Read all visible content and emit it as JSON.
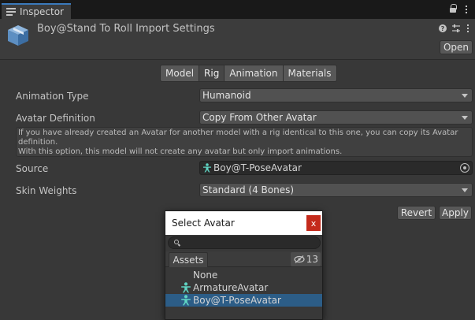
{
  "window": {
    "tab_label": "Inspector"
  },
  "header": {
    "title": "Boy@Stand To Roll Import Settings",
    "open_label": "Open"
  },
  "toolbar": {
    "tabs": [
      "Model",
      "Rig",
      "Animation",
      "Materials"
    ],
    "active": "Rig"
  },
  "rig": {
    "animation_type_label": "Animation Type",
    "animation_type_value": "Humanoid",
    "avatar_definition_label": "Avatar Definition",
    "avatar_definition_value": "Copy From Other Avatar",
    "help_lines": [
      "If you have already created an Avatar for another model with a rig identical to this one, you can copy its Avatar",
      "definition.",
      "With this option, this model will not create any avatar but only import animations."
    ],
    "source_label": "Source",
    "source_value": "Boy@T-PoseAvatar",
    "skin_weights_label": "Skin Weights",
    "skin_weights_value": "Standard (4 Bones)"
  },
  "actions": {
    "revert_label": "Revert",
    "apply_label": "Apply"
  },
  "popup": {
    "title": "Select Avatar",
    "close_glyph": "x",
    "search_placeholder": "",
    "assets_tab_label": "Assets",
    "hidden_count": "13",
    "items": [
      {
        "label": "None",
        "icon": ""
      },
      {
        "label": "ArmatureAvatar",
        "icon": "avatar-icon"
      },
      {
        "label": "Boy@T-PoseAvatar",
        "icon": "avatar-icon",
        "selected": true
      }
    ]
  },
  "colors": {
    "selection": "#2c5d87",
    "tab_accent": "#3a79bb",
    "close_button": "#c42b1c",
    "avatar_icon": "#5fd4c3"
  }
}
